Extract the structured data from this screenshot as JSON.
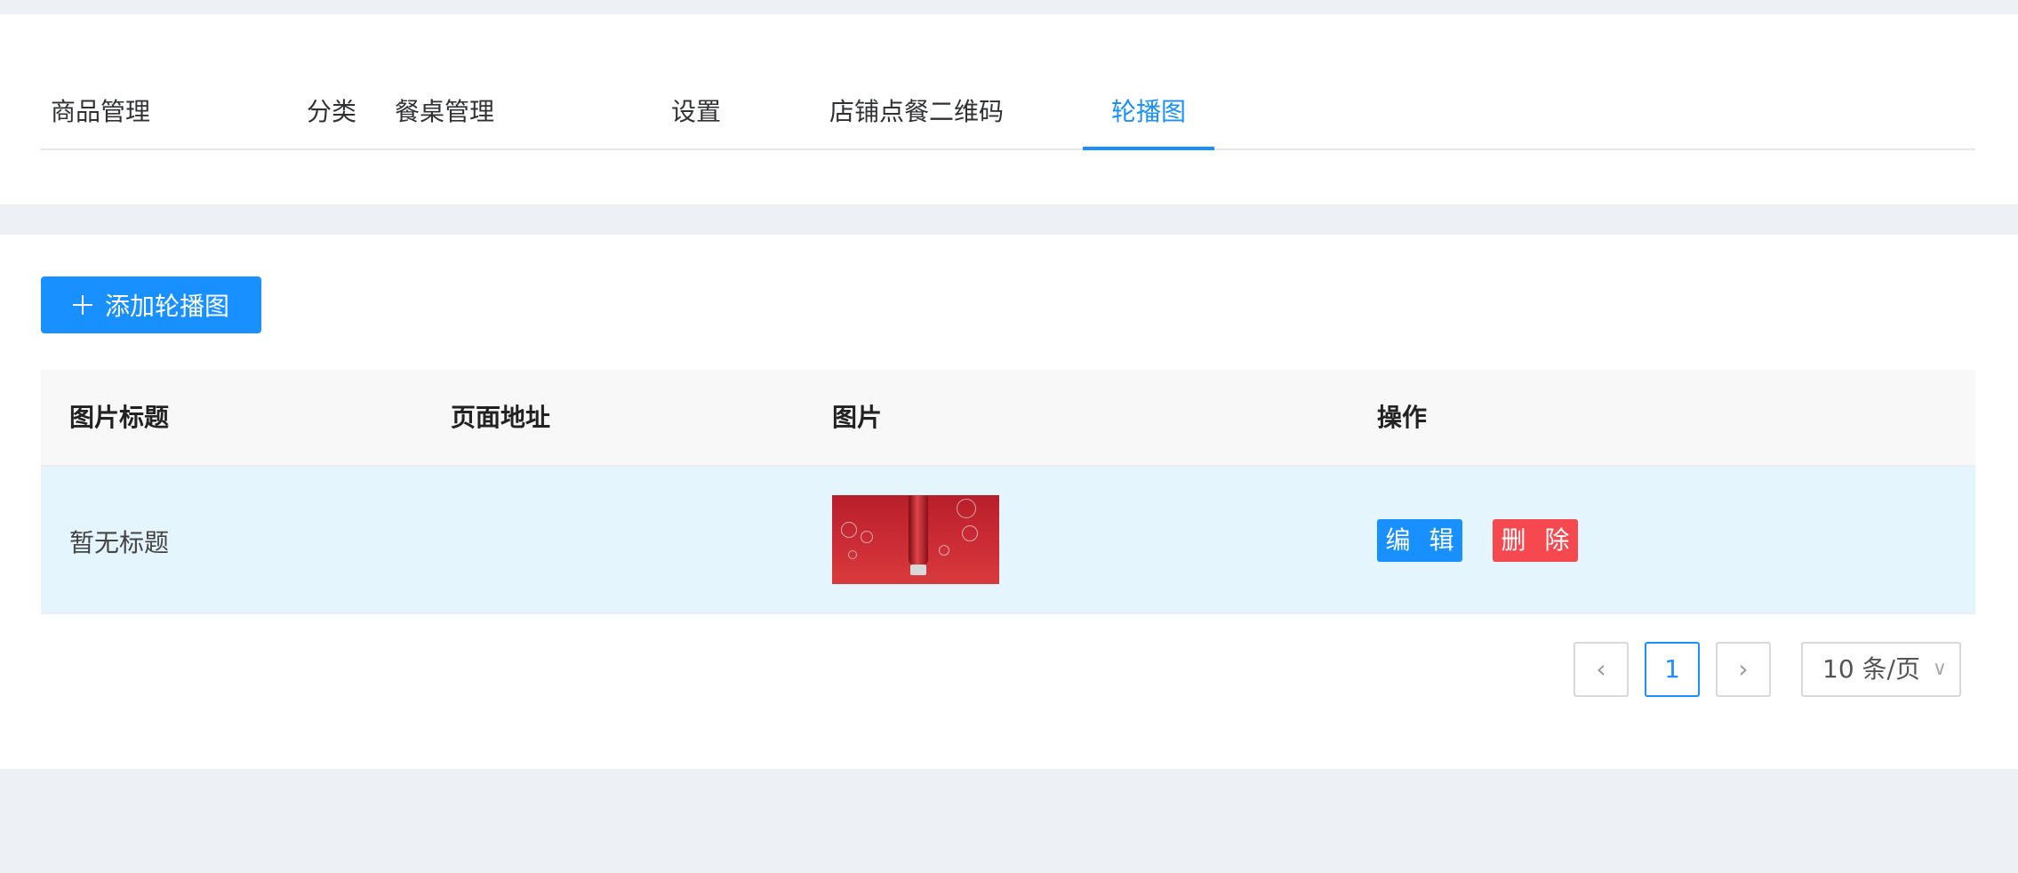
{
  "tabs": [
    {
      "label": "商品管理"
    },
    {
      "label": "分类"
    },
    {
      "label": "餐桌管理"
    },
    {
      "label": "设置"
    },
    {
      "label": "店铺点餐二维码"
    },
    {
      "label": "轮播图"
    }
  ],
  "active_tab": "轮播图",
  "toolbar": {
    "add_label": "添加轮播图",
    "add_icon": "plus-icon"
  },
  "table": {
    "columns": [
      "图片标题",
      "页面地址",
      "图片",
      "操作"
    ],
    "rows": [
      {
        "title": "暂无标题",
        "url": "",
        "image": "banner-thumbnail",
        "edit_label": "编 辑",
        "delete_label": "删 除"
      }
    ]
  },
  "pagination": {
    "prev_icon": "chevron-left-icon",
    "current_page": "1",
    "next_icon": "chevron-right-icon",
    "page_size": "10 条/页"
  },
  "colors": {
    "accent": "#1890ff",
    "danger": "#f5484f",
    "row_highlight": "#e5f5fd",
    "background": "#edf1f5"
  }
}
